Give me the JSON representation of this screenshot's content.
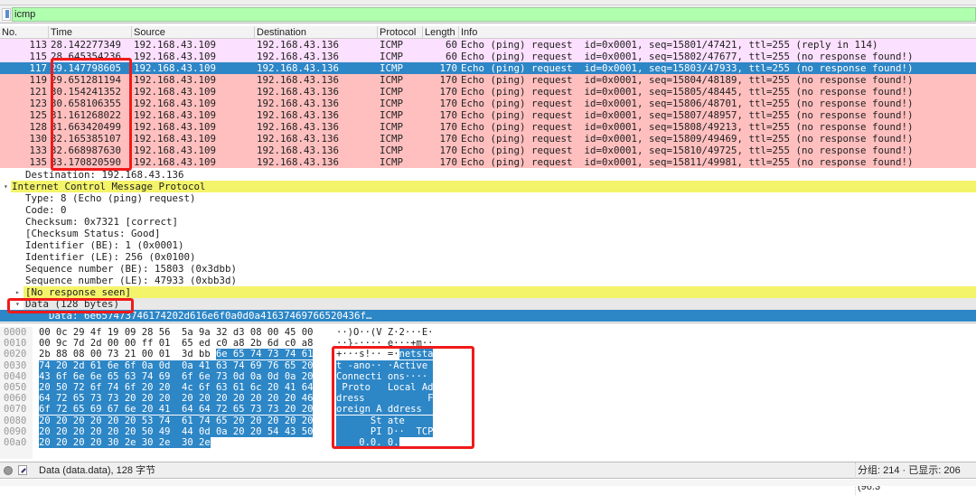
{
  "filter": {
    "value": "icmp"
  },
  "columns": [
    "No.",
    "Time",
    "Source",
    "Destination",
    "Protocol",
    "Length",
    "Info"
  ],
  "packets": [
    {
      "no": "113",
      "time": "28.142277349",
      "src": "192.168.43.109",
      "dst": "192.168.43.136",
      "proto": "ICMP",
      "len": "60",
      "info": "Echo (ping) request  id=0x0001, seq=15801/47421, ttl=255 (reply in 114)",
      "style": "reply"
    },
    {
      "no": "115",
      "time": "28.645354236",
      "src": "192.168.43.109",
      "dst": "192.168.43.136",
      "proto": "ICMP",
      "len": "60",
      "info": "Echo (ping) request  id=0x0001, seq=15802/47677, ttl=255 (no response found!)",
      "style": "reply"
    },
    {
      "no": "117",
      "time": "29.147798605",
      "src": "192.168.43.109",
      "dst": "192.168.43.136",
      "proto": "ICMP",
      "len": "170",
      "info": "Echo (ping) request  id=0x0001, seq=15803/47933, ttl=255 (no response found!)",
      "style": "sel"
    },
    {
      "no": "119",
      "time": "29.651281194",
      "src": "192.168.43.109",
      "dst": "192.168.43.136",
      "proto": "ICMP",
      "len": "170",
      "info": "Echo (ping) request  id=0x0001, seq=15804/48189, ttl=255 (no response found!)",
      "style": "err"
    },
    {
      "no": "121",
      "time": "30.154241352",
      "src": "192.168.43.109",
      "dst": "192.168.43.136",
      "proto": "ICMP",
      "len": "170",
      "info": "Echo (ping) request  id=0x0001, seq=15805/48445, ttl=255 (no response found!)",
      "style": "err"
    },
    {
      "no": "123",
      "time": "30.658106355",
      "src": "192.168.43.109",
      "dst": "192.168.43.136",
      "proto": "ICMP",
      "len": "170",
      "info": "Echo (ping) request  id=0x0001, seq=15806/48701, ttl=255 (no response found!)",
      "style": "err"
    },
    {
      "no": "125",
      "time": "31.161268022",
      "src": "192.168.43.109",
      "dst": "192.168.43.136",
      "proto": "ICMP",
      "len": "170",
      "info": "Echo (ping) request  id=0x0001, seq=15807/48957, ttl=255 (no response found!)",
      "style": "err"
    },
    {
      "no": "128",
      "time": "31.663420499",
      "src": "192.168.43.109",
      "dst": "192.168.43.136",
      "proto": "ICMP",
      "len": "170",
      "info": "Echo (ping) request  id=0x0001, seq=15808/49213, ttl=255 (no response found!)",
      "style": "err"
    },
    {
      "no": "130",
      "time": "32.165385107",
      "src": "192.168.43.109",
      "dst": "192.168.43.136",
      "proto": "ICMP",
      "len": "170",
      "info": "Echo (ping) request  id=0x0001, seq=15809/49469, ttl=255 (no response found!)",
      "style": "err"
    },
    {
      "no": "133",
      "time": "32.668987630",
      "src": "192.168.43.109",
      "dst": "192.168.43.136",
      "proto": "ICMP",
      "len": "170",
      "info": "Echo (ping) request  id=0x0001, seq=15810/49725, ttl=255 (no response found!)",
      "style": "err"
    },
    {
      "no": "135",
      "time": "33.170820590",
      "src": "192.168.43.109",
      "dst": "192.168.43.136",
      "proto": "ICMP",
      "len": "170",
      "info": "Echo (ping) request  id=0x0001, seq=15811/49981, ttl=255 (no response found!)",
      "style": "err"
    }
  ],
  "details": [
    {
      "text": "Destination: 192.168.43.136",
      "cls": "lvl1",
      "arrow": ""
    },
    {
      "text": "Internet Control Message Protocol",
      "cls": "lvl0 yellow",
      "arrow": "▾"
    },
    {
      "text": "Type: 8 (Echo (ping) request)",
      "cls": "lvl1",
      "arrow": ""
    },
    {
      "text": "Code: 0",
      "cls": "lvl1",
      "arrow": ""
    },
    {
      "text": "Checksum: 0x7321 [correct]",
      "cls": "lvl1",
      "arrow": ""
    },
    {
      "text": "[Checksum Status: Good]",
      "cls": "lvl1",
      "arrow": ""
    },
    {
      "text": "Identifier (BE): 1 (0x0001)",
      "cls": "lvl1",
      "arrow": ""
    },
    {
      "text": "Identifier (LE): 256 (0x0100)",
      "cls": "lvl1",
      "arrow": ""
    },
    {
      "text": "Sequence number (BE): 15803 (0x3dbb)",
      "cls": "lvl1",
      "arrow": ""
    },
    {
      "text": "Sequence number (LE): 47933 (0xbb3d)",
      "cls": "lvl1",
      "arrow": ""
    },
    {
      "text": "[No response seen]",
      "cls": "lvl1 nores",
      "arrow": "▸"
    },
    {
      "text": "Data (128 bytes)",
      "cls": "lvl1 datahdr",
      "arrow": "▾"
    },
    {
      "text": "    Data: 6e657473746174202d616e6f0a0d0a41637469766520436f…",
      "cls": "lvl1 selected",
      "arrow": ""
    }
  ],
  "hex": [
    {
      "off": "0000",
      "hp": "00 0c 29 4f 19 09 28 56  5a 9a 32 d3 08 00 45 00",
      "hs": "",
      "ap": "··)O··(V Z·2···E·",
      "as": ""
    },
    {
      "off": "0010",
      "hp": "00 9c 7d 2d 00 00 ff 01  65 ed c0 a8 2b 6d c0 a8",
      "hs": "",
      "ap": "··}-···· e···+m··",
      "as": ""
    },
    {
      "off": "0020",
      "hp": "2b 88 08 00 73 21 00 01  3d bb ",
      "hs": "6e 65 74 73 74 61",
      "ap": "+···s!·· =·",
      "as": "netsta"
    },
    {
      "off": "0030",
      "hp": "",
      "hs": "74 20 2d 61 6e 6f 0a 0d  0a 41 63 74 69 76 65 20",
      "ap": "",
      "as": "t -ano·· ·Active "
    },
    {
      "off": "0040",
      "hp": "",
      "hs": "43 6f 6e 6e 65 63 74 69  6f 6e 73 0d 0a 0d 0a 20",
      "ap": "",
      "as": "Connecti ons···· "
    },
    {
      "off": "0050",
      "hp": "",
      "hs": "20 50 72 6f 74 6f 20 20  4c 6f 63 61 6c 20 41 64",
      "ap": "",
      "as": " Proto   Local Ad"
    },
    {
      "off": "0060",
      "hp": "",
      "hs": "64 72 65 73 73 20 20 20  20 20 20 20 20 20 20 46",
      "ap": "",
      "as": "dress           F"
    },
    {
      "off": "0070",
      "hp": "",
      "hs": "6f 72 65 69 67 6e 20 41  64 64 72 65 73 73 20 20",
      "ap": "",
      "as": "oreign A ddress  "
    },
    {
      "off": "0080",
      "hp": "",
      "hs": "20 20 20 20 20 20 53 74  61 74 65 20 20 20 20 20",
      "ap": "",
      "as": "      St ate     "
    },
    {
      "off": "0090",
      "hp": "",
      "hs": "20 20 20 20 20 20 50 49  44 0d 0a 20 20 54 43 50",
      "ap": "",
      "as": "      PI D··  TCP"
    },
    {
      "off": "00a0",
      "hp": "",
      "hs": "20 20 20 20 30 2e 30 2e  30 2e",
      "ap": "",
      "as": "    0.0. 0."
    }
  ],
  "status": {
    "field": "Data (data.data), 128 字节",
    "packets": "分组: 214 · 已显示: 206 (96.3"
  }
}
